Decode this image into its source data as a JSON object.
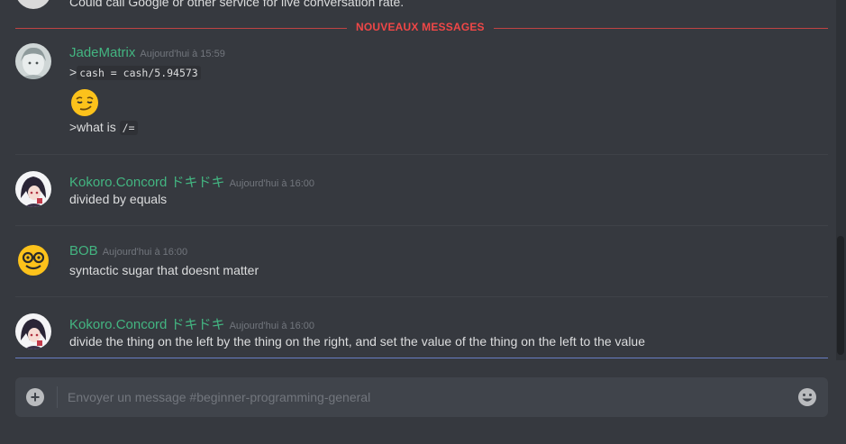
{
  "top_message": {
    "text": "Could call Google or other service for live conversation rate."
  },
  "divider": {
    "label": "NOUVEAUX MESSAGES"
  },
  "messages": [
    {
      "author": "JadeMatrix",
      "timestamp": "Aujourd'hui à 15:59",
      "lines": {
        "quote_prefix": ">",
        "code": "cash = cash/5.94573",
        "emoji": "smirk-emoji",
        "text": ">what is ",
        "code2": "/="
      }
    },
    {
      "author": "Kokoro.Concord ドキドキ",
      "timestamp": "Aujourd'hui à 16:00",
      "text": "divided by equals"
    },
    {
      "author": "BOB",
      "timestamp": "Aujourd'hui à 16:00",
      "text": "syntactic sugar that doesnt matter"
    },
    {
      "author": "Kokoro.Concord ドキドキ",
      "timestamp": "Aujourd'hui à 16:00",
      "text": "divide the thing on the left by the thing on the right, and set the value of the thing on the left to the value"
    }
  ],
  "composer": {
    "placeholder": "Envoyer un message #beginner-programming-general"
  },
  "icons": {
    "add": "plus-circle-icon",
    "emoji_picker": "smiley-icon"
  },
  "colors": {
    "background": "#36393f",
    "username": "#43b581",
    "new_messages": "#f04747",
    "composer": "#40444b"
  }
}
